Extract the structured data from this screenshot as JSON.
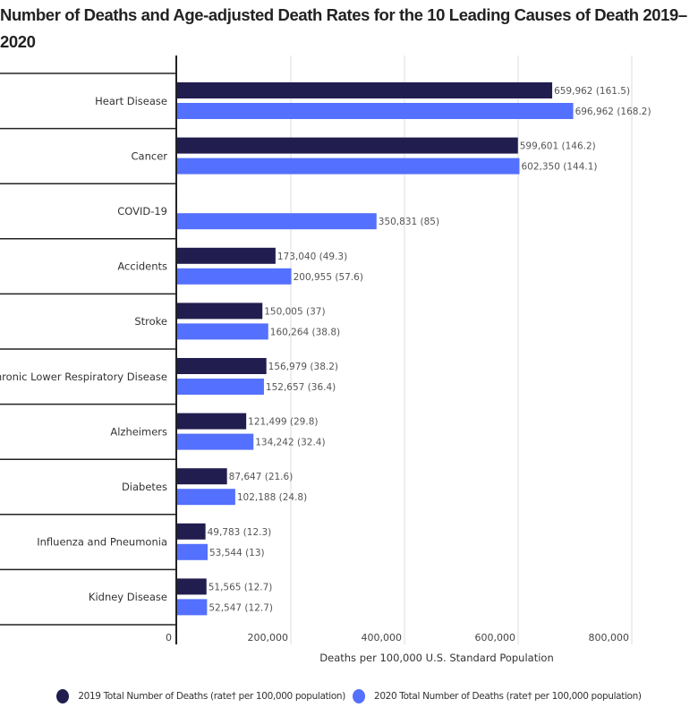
{
  "chart_data": {
    "type": "bar",
    "orientation": "horizontal",
    "title": "Number of Deaths and Age-adjusted Death Rates for the 10 Leading Causes of Death 2019–2020",
    "xlabel": "Deaths per 100,000 U.S. Standard Population",
    "ylabel": "",
    "xlim": [
      0,
      800000
    ],
    "xticks": [
      0,
      200000,
      400000,
      600000,
      800000
    ],
    "xtick_labels": [
      "0",
      "200,000",
      "400,000",
      "600,000",
      "800,000"
    ],
    "grid": true,
    "legend_position": "bottom",
    "categories": [
      "Heart Disease",
      "Cancer",
      "COVID-19",
      "Accidents",
      "Stroke",
      "Chronic Lower Respiratory Disease",
      "Alzheimers",
      "Diabetes",
      "Influenza and Pneumonia",
      "Kidney Disease"
    ],
    "series": [
      {
        "name": "2019 Total Number of Deaths (rate† per 100,000 population)",
        "color": "#211d4f",
        "values": [
          659962,
          599601,
          null,
          173040,
          150005,
          156979,
          121499,
          87647,
          49783,
          51565
        ],
        "rates": [
          161.5,
          146.2,
          null,
          49.3,
          37,
          38.2,
          29.8,
          21.6,
          12.3,
          12.7
        ],
        "labels": [
          "659,962 (161.5)",
          "599,601 (146.2)",
          "",
          "173,040 (49.3)",
          "150,005 (37)",
          "156,979 (38.2)",
          "121,499 (29.8)",
          "87,647 (21.6)",
          "49,783 (12.3)",
          "51,565 (12.7)"
        ]
      },
      {
        "name": "2020 Total Number of Deaths (rate† per 100,000 population)",
        "color": "#5470fe",
        "values": [
          696962,
          602350,
          350831,
          200955,
          160264,
          152657,
          134242,
          102188,
          53544,
          52547
        ],
        "rates": [
          168.2,
          144.1,
          85,
          57.6,
          38.8,
          36.4,
          32.4,
          24.8,
          13,
          12.7
        ],
        "labels": [
          "696,962 (168.2)",
          "602,350 (144.1)",
          "350,831 (85)",
          "200,955 (57.6)",
          "160,264 (38.8)",
          "152,657 (36.4)",
          "134,242 (32.4)",
          "102,188 (24.8)",
          "53,544 (13)",
          "52,547 (12.7)"
        ]
      }
    ]
  }
}
